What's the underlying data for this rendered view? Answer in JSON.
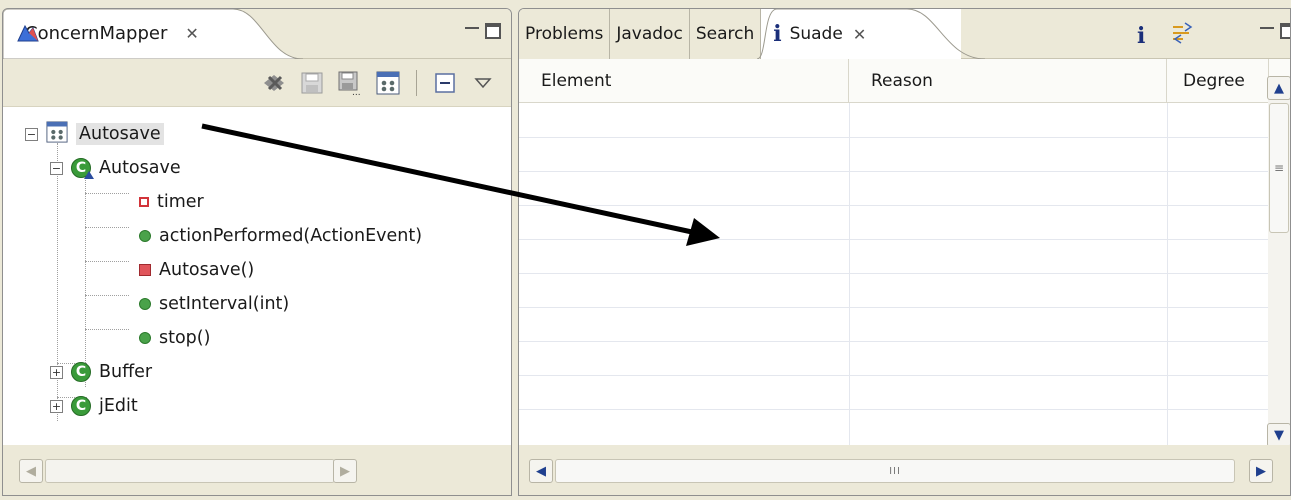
{
  "left_view": {
    "tab_title": "ConcernMapper",
    "close_glyph": "✕",
    "toolbar_icons": [
      "clear-icon",
      "save-icon",
      "save-as-icon",
      "new-concern-icon",
      "collapse-all-icon",
      "view-menu-icon"
    ],
    "tree": [
      {
        "label": "Autosave",
        "kind": "concern",
        "level": 0,
        "expander": "−",
        "selected": true
      },
      {
        "label": "Autosave",
        "kind": "class",
        "level": 1,
        "expander": "−"
      },
      {
        "label": "timer",
        "kind": "field",
        "level": 2
      },
      {
        "label": "actionPerformed(ActionEvent)",
        "kind": "method-public",
        "level": 2
      },
      {
        "label": "Autosave()",
        "kind": "constructor",
        "level": 2
      },
      {
        "label": "setInterval(int)",
        "kind": "method-public",
        "level": 2
      },
      {
        "label": "stop()",
        "kind": "method-public",
        "level": 2
      },
      {
        "label": "Buffer",
        "kind": "class",
        "level": 1,
        "expander": "+"
      },
      {
        "label": "jEdit",
        "kind": "class",
        "level": 1,
        "expander": "+"
      }
    ]
  },
  "right_view": {
    "tabs": [
      {
        "label": "Problems",
        "active": false
      },
      {
        "label": "Javadoc",
        "active": false
      },
      {
        "label": "Search",
        "active": false
      },
      {
        "label": "Suade",
        "active": true
      }
    ],
    "columns": [
      "Element",
      "Reason",
      "Degree"
    ],
    "scroll_mid_glyph": "III",
    "vscroll_mid_glyph": "≡"
  },
  "colors": {
    "chrome": "#ece9d8",
    "class_green": "#3a9b3a",
    "field_red": "#d2343a",
    "info_blue": "#1b2f7a",
    "arrow": "#000000"
  }
}
